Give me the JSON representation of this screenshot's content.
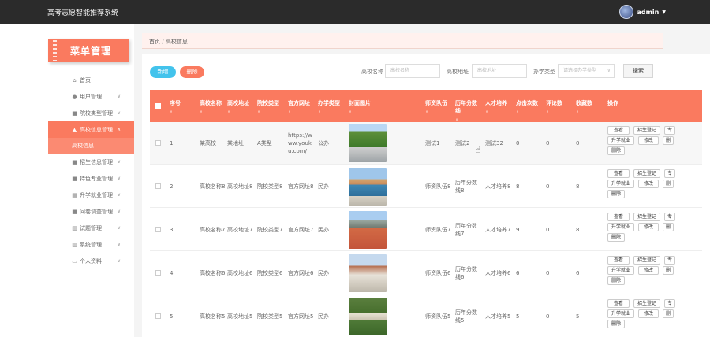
{
  "app": {
    "title": "高考志愿智能推荐系统",
    "user": "admin"
  },
  "sidebar": {
    "menu_title": "菜单管理",
    "items": [
      {
        "label": "首页",
        "icon": "home-icon",
        "has_children": false
      },
      {
        "label": "用户管理",
        "icon": "location-pin-icon",
        "has_children": true
      },
      {
        "label": "院校类型管理",
        "icon": "grid-icon",
        "has_children": true
      },
      {
        "label": "高校信息管理",
        "icon": "school-icon",
        "has_children": true,
        "active": true
      },
      {
        "label": "招生信息管理",
        "icon": "grid-icon",
        "has_children": true
      },
      {
        "label": "特色专业管理",
        "icon": "grid-icon",
        "has_children": true
      },
      {
        "label": "升学就业管理",
        "icon": "table-icon",
        "has_children": true
      },
      {
        "label": "问卷调查管理",
        "icon": "grid-icon",
        "has_children": true
      },
      {
        "label": "试题管理",
        "icon": "bank-icon",
        "has_children": true
      },
      {
        "label": "系统管理",
        "icon": "bank-icon",
        "has_children": true
      },
      {
        "label": "个人资料",
        "icon": "card-icon",
        "has_children": true
      }
    ],
    "active_sub": "高校信息"
  },
  "breadcrumb": {
    "home": "首页",
    "sep": "/",
    "current": "高校信息"
  },
  "toolbar": {
    "add_label": "新增",
    "delete_label": "删除",
    "filters": [
      {
        "label": "高校名称",
        "placeholder": "高校名称"
      },
      {
        "label": "高校地址",
        "placeholder": "高校地址"
      },
      {
        "label": "办学类型",
        "placeholder": "请选择办学类型"
      }
    ],
    "search_label": "搜索"
  },
  "table": {
    "headers": [
      "序号",
      "高校名称",
      "高校地址",
      "院校类型",
      "官方网址",
      "办学类型",
      "封面图片",
      "师资队伍",
      "历年分数线",
      "人才培养",
      "点击次数",
      "评论数",
      "收藏数",
      "操作"
    ],
    "sort_icon": "⇕",
    "rows": [
      {
        "idx": "1",
        "name": "某高校",
        "addr": "某地址",
        "type": "A类型",
        "url": "https://www.youku.com/",
        "school_type": "公办",
        "teachers": "测试1",
        "scores": "测试2",
        "talent": "测试32",
        "clicks": "0",
        "comments": "0",
        "favs": "0"
      },
      {
        "idx": "2",
        "name": "高校名称8",
        "addr": "高校地址8",
        "type": "院校类型8",
        "url": "官方网址8",
        "school_type": "民办",
        "teachers": "师资队伍8",
        "scores": "历年分数线8",
        "talent": "人才培养8",
        "clicks": "8",
        "comments": "0",
        "favs": "8"
      },
      {
        "idx": "3",
        "name": "高校名称7",
        "addr": "高校地址7",
        "type": "院校类型7",
        "url": "官方网址7",
        "school_type": "民办",
        "teachers": "师资队伍7",
        "scores": "历年分数线7",
        "talent": "人才培养7",
        "clicks": "9",
        "comments": "0",
        "favs": "8"
      },
      {
        "idx": "4",
        "name": "高校名称6",
        "addr": "高校地址6",
        "type": "院校类型6",
        "url": "官方网址6",
        "school_type": "民办",
        "teachers": "师资队伍6",
        "scores": "历年分数线6",
        "talent": "人才培养6",
        "clicks": "6",
        "comments": "0",
        "favs": "6"
      },
      {
        "idx": "5",
        "name": "高校名称5",
        "addr": "高校地址5",
        "type": "院校类型5",
        "url": "官方网址5",
        "school_type": "民办",
        "teachers": "师资队伍5",
        "scores": "历年分数线5",
        "talent": "人才培养5",
        "clicks": "5",
        "comments": "0",
        "favs": "5"
      }
    ],
    "ops": {
      "view": "查看",
      "enroll": "招生登记",
      "major": "专",
      "career": "升学就业",
      "edit": "修改",
      "more": "删",
      "delete": "删除"
    }
  },
  "colors": {
    "accent": "#fa7a5f",
    "topbar": "#2b2b2b",
    "add_button": "#43c3ec"
  }
}
